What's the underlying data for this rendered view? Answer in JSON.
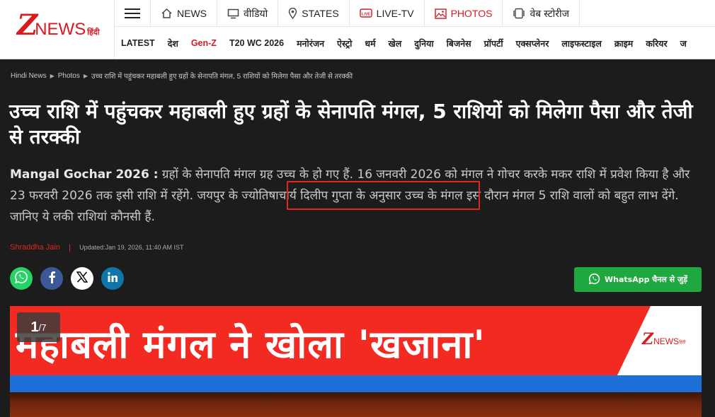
{
  "header": {
    "logo": {
      "z": "Z",
      "news": "NEWS",
      "hindi": "हिंदी"
    },
    "topnav": [
      {
        "label": "NEWS",
        "icon": "home-icon"
      },
      {
        "label": "वीडियो",
        "icon": "monitor-icon"
      },
      {
        "label": "STATES",
        "icon": "location-pin-icon"
      },
      {
        "label": "LIVE-TV",
        "icon": "live-tv-icon"
      },
      {
        "label": "PHOTOS",
        "icon": "photo-icon"
      },
      {
        "label": "वेब स्टोरीज",
        "icon": "web-stories-icon"
      }
    ],
    "secnav": [
      "LATEST",
      "देश",
      "Gen-Z",
      "T20 WC 2026",
      "मनोरंजन",
      "ऐस्ट्रो",
      "धर्म",
      "खेल",
      "दुनिया",
      "बिजनेस",
      "प्रॉपर्टी",
      "एक्सप्लेनर",
      "लाइफस्टाइल",
      "क्राइम",
      "करियर",
      "ज"
    ]
  },
  "breadcrumb": {
    "home": "Hindi News",
    "section": "Photos",
    "current": "उच्च राशि में पहुंचकर महाबली हुए ग्रहों के सेनापति मंगल, 5 राशियों को मिलेगा पैसा और तेजी से तरक्की"
  },
  "article": {
    "title": "उच्च राशि में पहुंचकर महाबली हुए ग्रहों के सेनापति मंगल, 5 राशियों को मिलेगा पैसा और तेजी से तरक्की",
    "summary_lead": "Mangal Gochar 2026 :",
    "summary_part1": " ग्रहों के सेनापति मंगल ग्रह उच्च के हो गए हैं. 16 जनवरी 2026 को मंगल ने गोचर करके मकर राशि में प्रवेश किया है और 23 फरवरी 2026 तक इसी राशि में रहेंगे. ",
    "summary_highlight": "जयपुर के ज्योतिषाचार्य दिलीप गुप्ता",
    "summary_part2": " के अनुसार उच्च के मंगल इस दौरान मंगल 5 राशि वालों को बहुत लाभ देंगे. जानिए ये लकी राशियां कौनसी हैं.",
    "author": "Shraddha Jain",
    "separator": "|",
    "updated": "Updated:Jan 19, 2026, 11:40 AM IST"
  },
  "share": {
    "icons": [
      "whatsapp-icon",
      "facebook-icon",
      "x-icon",
      "linkedin-icon"
    ],
    "whatsapp_channel": "WhatsApp चैनल से जुड़ें"
  },
  "gallery": {
    "current": "1",
    "total": "/7",
    "headline": "महाबली मंगल ने खोला 'खजाना'",
    "watermark": {
      "z": "Z",
      "news": "NEWS",
      "hindi": "हिंदी"
    }
  },
  "colors": {
    "brand": "#d71920",
    "whatsapp": "#25d366",
    "highlight_border": "#e0261d",
    "background": "#1c1c1c"
  }
}
